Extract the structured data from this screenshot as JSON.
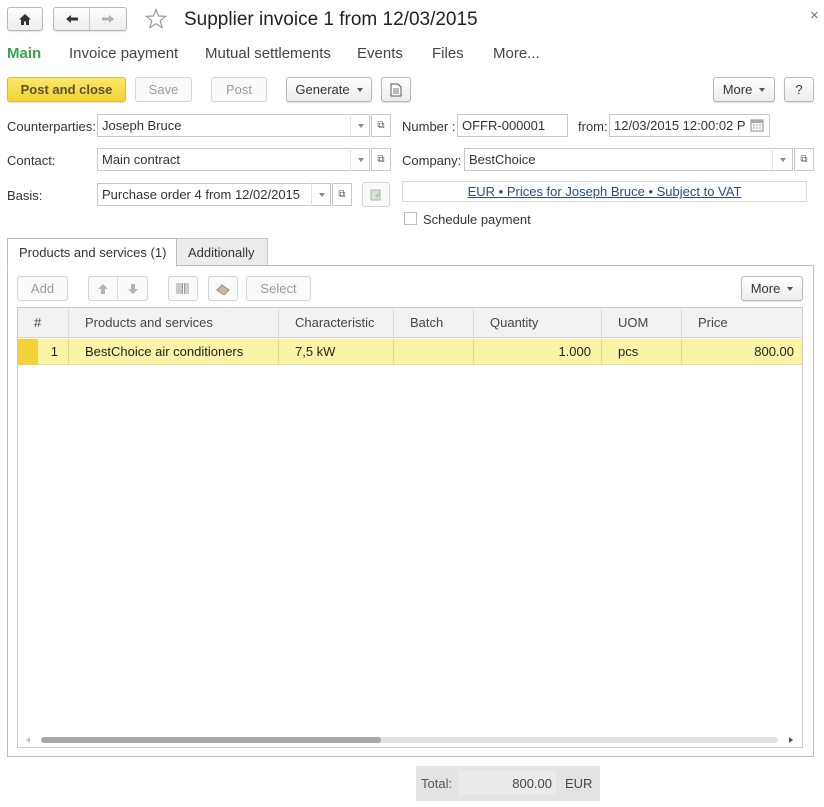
{
  "window": {
    "title": "Supplier invoice 1 from 12/03/2015",
    "close_glyph": "×"
  },
  "nav_tabs": [
    {
      "label": "Main",
      "active": true
    },
    {
      "label": "Invoice payment"
    },
    {
      "label": "Mutual settlements"
    },
    {
      "label": "Events"
    },
    {
      "label": "Files"
    },
    {
      "label": "More..."
    }
  ],
  "toolbar": {
    "post_and_close": "Post and close",
    "save": "Save",
    "post": "Post",
    "generate": "Generate",
    "more": "More",
    "help": "?"
  },
  "form": {
    "counterparties_label": "Counterparties:",
    "counterparties_value": "Joseph Bruce",
    "contact_label": "Contact:",
    "contact_value": "Main contract",
    "basis_label": "Basis:",
    "basis_value": "Purchase order 4 from 12/02/2015",
    "number_label": "Number :",
    "number_value": "OFFR-000001",
    "from_label": "from:",
    "from_value": "12/03/2015 12:00:02 P",
    "company_label": "Company:",
    "company_value": "BestChoice",
    "prices_link": "EUR • Prices for Joseph Bruce • Subject to VAT",
    "schedule_payment_label": "Schedule payment",
    "schedule_payment_checked": false
  },
  "content_tabs": [
    {
      "label": "Products and services (1)",
      "active": true
    },
    {
      "label": "Additionally"
    }
  ],
  "table_toolbar": {
    "add": "Add",
    "select": "Select",
    "more": "More"
  },
  "table": {
    "columns": [
      "#",
      "Products and services",
      "Characteristic",
      "Batch",
      "Quantity",
      "UOM",
      "Price"
    ],
    "rows": [
      {
        "num": "1",
        "product": "BestChoice air conditioners",
        "characteristic": "7,5 kW",
        "batch": "",
        "quantity": "1.000",
        "uom": "pcs",
        "price": "800.00"
      }
    ]
  },
  "totals": {
    "label": "Total:",
    "value": "800.00",
    "currency": "EUR"
  },
  "colors": {
    "accent_green": "#3fa34d",
    "selected_row": "#fbf3a6",
    "row_marker": "#f4d23a",
    "primary_button": "#f5dc4a",
    "link": "#2a4a8a"
  }
}
